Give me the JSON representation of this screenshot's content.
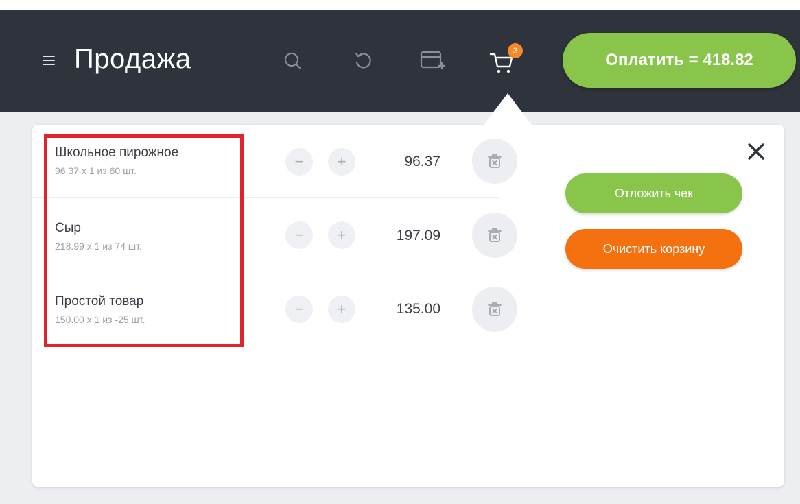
{
  "header": {
    "title": "Продажа",
    "menu_icon": "hamburger-icon",
    "icons": [
      "search-icon",
      "undo-icon",
      "card-add-icon",
      "cart-icon"
    ],
    "cart_count": "3",
    "pay_label": "Оплатить = 418.82",
    "colors": {
      "background": "#2f343c",
      "pay": "#8ac54b",
      "badge": "#f68a2a"
    }
  },
  "cart": {
    "items": [
      {
        "name": "Школьное пирожное",
        "desc": "96.37 x 1 из 60 шт.",
        "minus": "−",
        "plus": "+",
        "total": "96.37"
      },
      {
        "name": "Сыр",
        "desc": "218.99 x 1 из 74 шт.",
        "minus": "−",
        "plus": "+",
        "total": "197.09"
      },
      {
        "name": "Простой товар",
        "desc": "150.00 x 1 из -25 шт.",
        "minus": "−",
        "plus": "+",
        "total": "135.00"
      }
    ],
    "postpone_label": "Отложить чек",
    "clear_label": "Очистить корзину",
    "colors": {
      "postpone": "#8ac54b",
      "clear": "#f5700f",
      "highlight": "#e1232c"
    }
  }
}
